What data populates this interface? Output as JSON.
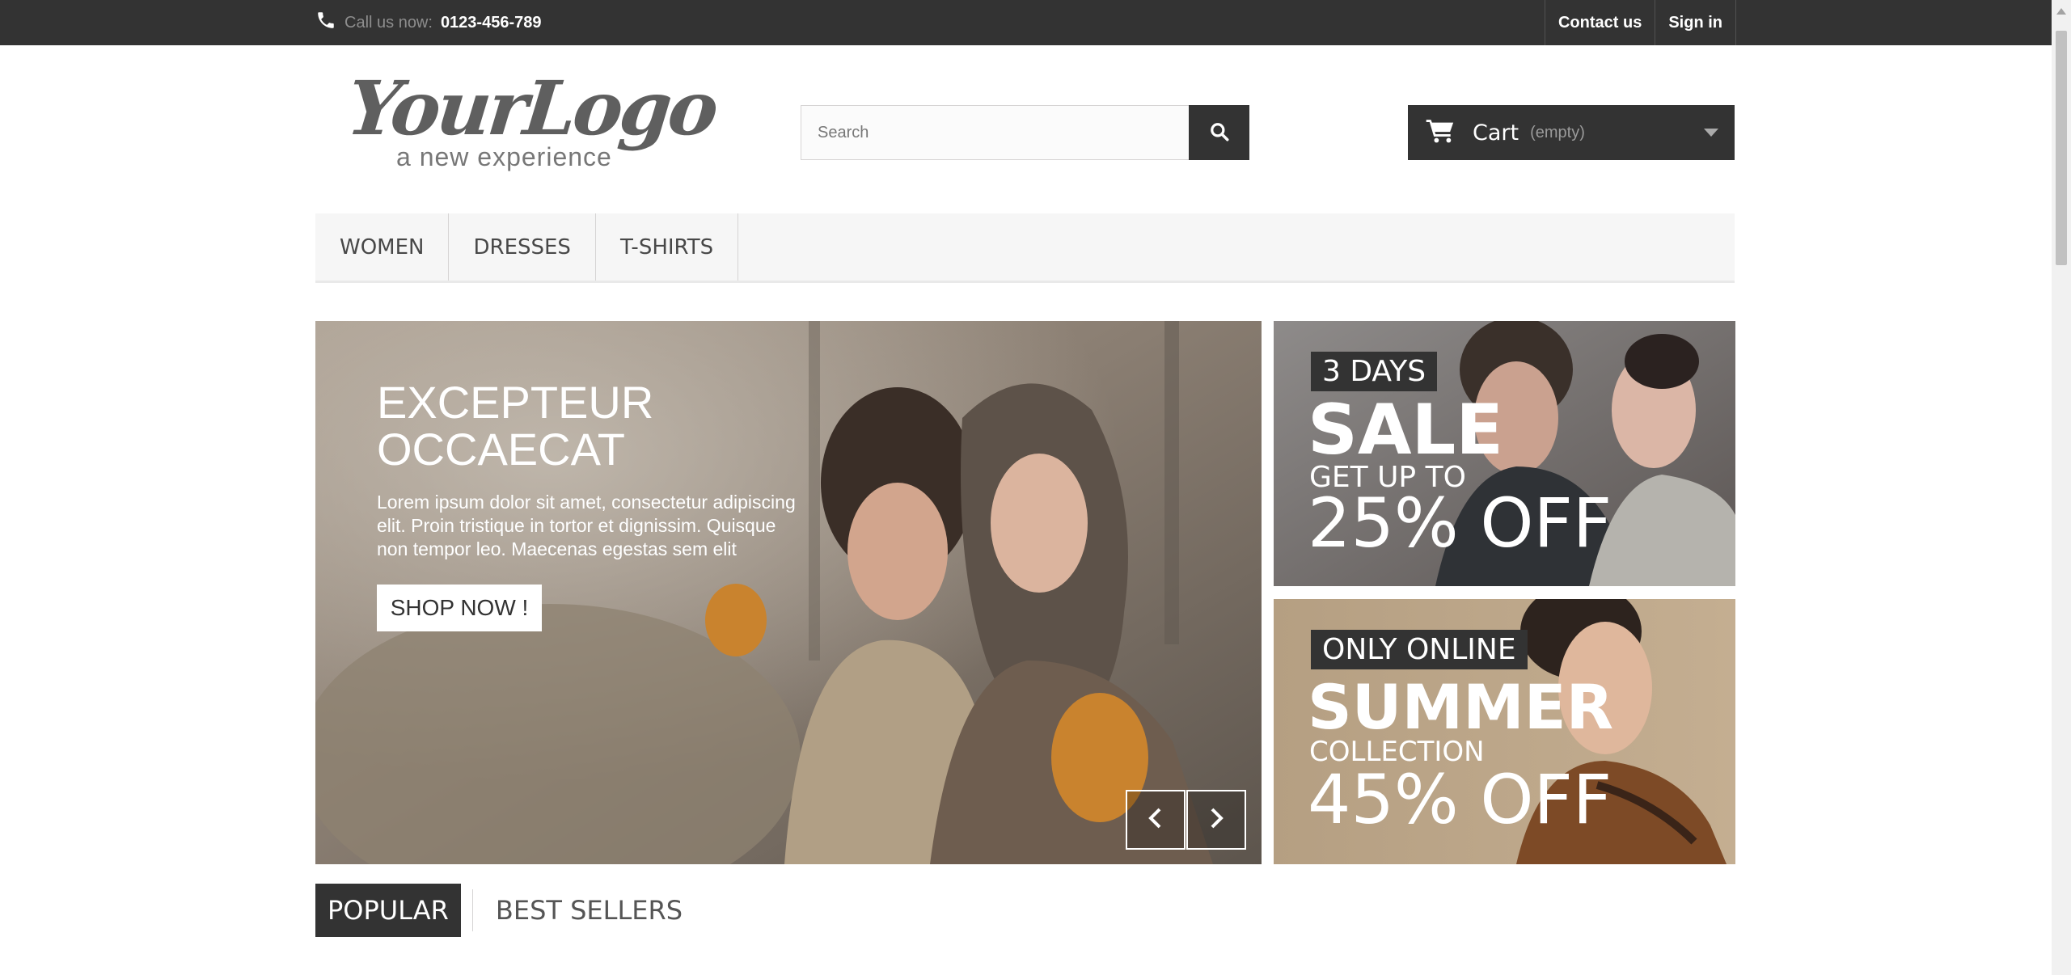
{
  "topbar": {
    "call_label": "Call us now:",
    "phone": "0123-456-789",
    "contact_label": "Contact us",
    "signin_label": "Sign in"
  },
  "header": {
    "logo_text": "YourLogo",
    "logo_tagline": "a new experience",
    "search_placeholder": "Search",
    "cart_label": "Cart",
    "cart_status": "(empty)"
  },
  "menu": {
    "items": [
      "Women",
      "Dresses",
      "T-shirts"
    ]
  },
  "slider": {
    "title_line1": "EXCEPTEUR",
    "title_line2": "OCCAECAT",
    "description": "Lorem ipsum dolor sit amet, consectetur adipiscing elit. Proin tristique in tortor et dignissim. Quisque non tempor leo. Maecenas egestas sem elit",
    "button_label": "SHOP NOW !"
  },
  "banners": [
    {
      "tag": "3 DAYS",
      "headline": "SALE",
      "subline": "GET UP TO",
      "offer": "25% OFF"
    },
    {
      "tag": "ONLY ONLINE",
      "headline": "SUMMER",
      "subline": "COLLECTION",
      "offer": "45% OFF"
    }
  ],
  "tabs": {
    "active": "POPULAR",
    "inactive": "BEST SELLERS"
  }
}
